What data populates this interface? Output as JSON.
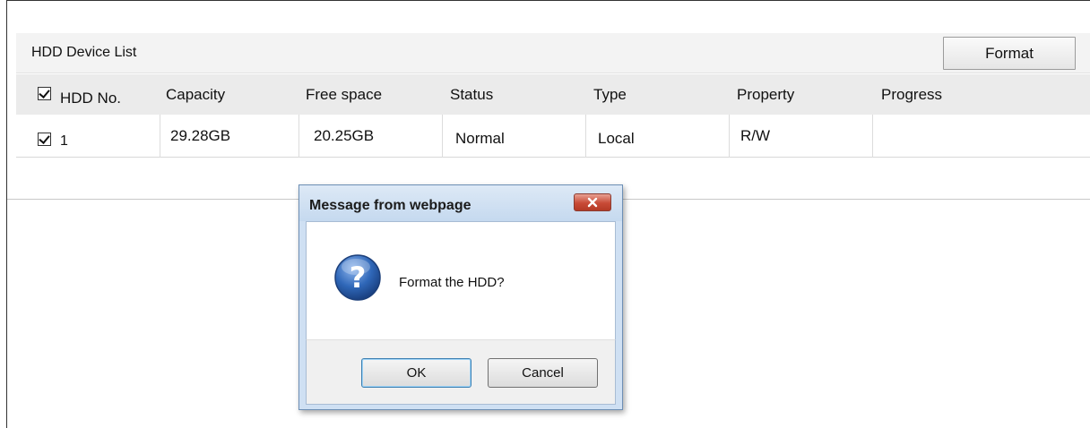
{
  "panel": {
    "title": "HDD Device List",
    "format_label": "Format"
  },
  "table": {
    "columns": [
      "HDD No.",
      "Capacity",
      "Free space",
      "Status",
      "Type",
      "Property",
      "Progress"
    ],
    "header_checkbox_checked": true,
    "rows": [
      {
        "checked": true,
        "hdd_no": "1",
        "capacity": "29.28GB",
        "free_space": "20.25GB",
        "status": "Normal",
        "type": "Local",
        "property": "R/W",
        "progress": ""
      }
    ]
  },
  "dialog": {
    "title": "Message from webpage",
    "message": "Format the HDD?",
    "ok_label": "OK",
    "cancel_label": "Cancel",
    "icon": "question-icon"
  },
  "colors": {
    "header_bg": "#f3f3f3",
    "table_head_bg": "#ebebeb",
    "dialog_frame": "#cfe0f3",
    "close_button": "#c84a36",
    "question_icon": "#2a5ea8"
  }
}
